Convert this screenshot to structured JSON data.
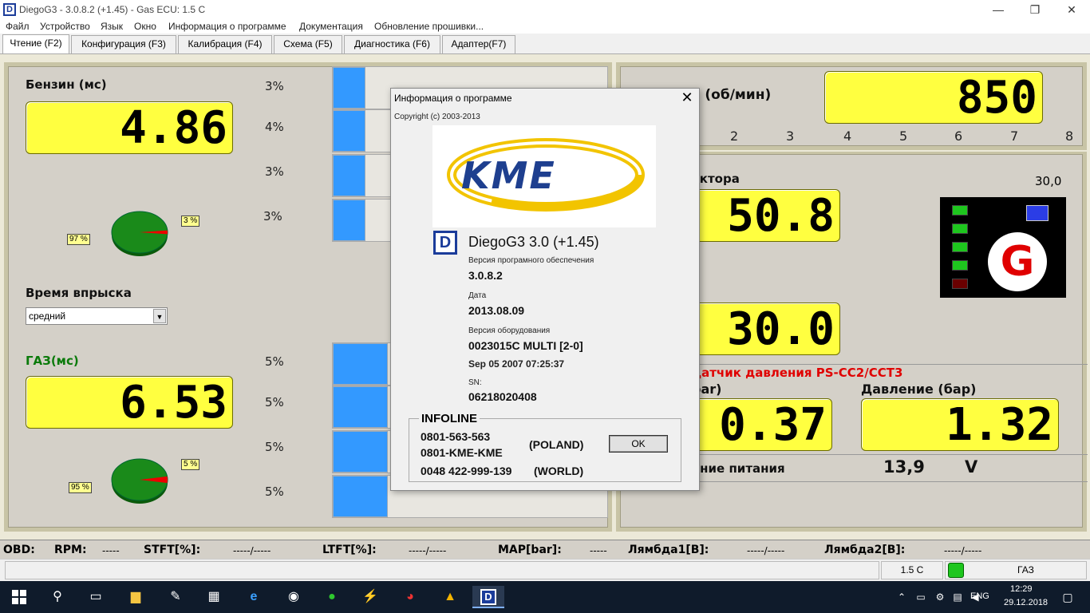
{
  "window": {
    "title": "DiegoG3 - 3.0.8.2 (+1.45) - Gas ECU: 1.5 C",
    "min": "—",
    "max": "❐",
    "close": "✕"
  },
  "menu": [
    "Файл",
    "Устройство",
    "Язык",
    "Окно",
    "Информация о программе",
    "Документация",
    "Обновление прошивки..."
  ],
  "tabs": [
    "Чтение (F2)",
    "Конфигурация (F3)",
    "Калибрация (F4)",
    "Схема (F5)",
    "Диагностика (F6)",
    "Адаптер(F7)"
  ],
  "petrol": {
    "label": "Бензин (мс)",
    "value": "4.86",
    "bars_pct": [
      "3%",
      "4%",
      "3%",
      "3%"
    ],
    "bar_fill": [
      0.12,
      0.12,
      0.12,
      0.12
    ],
    "pie_big": "97 %",
    "pie_small": "3 %",
    "pie_share": 0.03
  },
  "injection": {
    "label": "Время впрыска",
    "select": "средний"
  },
  "gas": {
    "label": "ГАЗ(мс)",
    "value": "6.53",
    "bars_pct": [
      "5%",
      "5%",
      "5%",
      "5%"
    ],
    "bar_fill": [
      0.2,
      0.2,
      0.2,
      0.2
    ],
    "pie_big": "95 %",
    "pie_small": "5 %",
    "pie_share": 0.05
  },
  "rpm": {
    "label": "RPM (об/мин)",
    "value": "850",
    "scale": [
      "2",
      "3",
      "4",
      "5",
      "6",
      "7",
      "8"
    ]
  },
  "reducer": {
    "label_partial": "уктора",
    "right_value": "30,0",
    "value1": "50.8",
    "value2": "30.0"
  },
  "switch": {
    "led_colors": [
      "#1ec61e",
      "#1ec61e",
      "#1ec61e",
      "#1ec61e",
      "#6a0000"
    ],
    "blue": "#2b3de6",
    "letter": "G"
  },
  "pressure": {
    "sensor": "датчик давления PS-CC2/CCT3",
    "left_label": "bar)",
    "left_value": "0.37",
    "right_label": "Давление (бар)",
    "right_value": "1.32"
  },
  "power": {
    "label": "ение питания",
    "value": "13,9",
    "unit": "V"
  },
  "obd": {
    "obd": "OBD:",
    "rpm": "RPM:",
    "rpm_v": "-----",
    "stft": "STFT[%]:",
    "stft_v": "-----/-----",
    "ltft": "LTFT[%]:",
    "ltft_v": "-----/-----",
    "map": "MAP[bar]:",
    "map_v": "-----",
    "l1": "Лямбда1[В]:",
    "l1_v": "-----/-----",
    "l2": "Лямбда2[В]:",
    "l2_v": "-----/-----"
  },
  "status": {
    "ecu": "1.5 C",
    "mode": "ГАЗ",
    "led": "#1ec61e"
  },
  "dialog": {
    "title": "Информация о программе",
    "copyright": "Copyright (c) 2003-2013",
    "logo": "KME",
    "app": "DiegoG3 3.0 (+1.45)",
    "sw_label": "Версия програмного обеспечения",
    "sw_value": "3.0.8.2",
    "date_label": "Дата",
    "date_value": "2013.08.09",
    "hw_label": "Версия оборудования",
    "hw_value": "0023015C MULTI [2-0]",
    "hw_date": "Sep 05 2007 07:25:37",
    "sn_label": "SN:",
    "sn_value": "06218020408",
    "infoline": "INFOLINE",
    "phone1": "0801-563-563",
    "phone2": "0801-KME-KME",
    "poland": "(POLAND)",
    "phone3": "0048 422-999-139",
    "world": "(WORLD)",
    "ok": "OK",
    "close": "✕"
  },
  "taskbar": {
    "lang": "ENG",
    "time": "12:29",
    "date": "29.12.2018"
  }
}
